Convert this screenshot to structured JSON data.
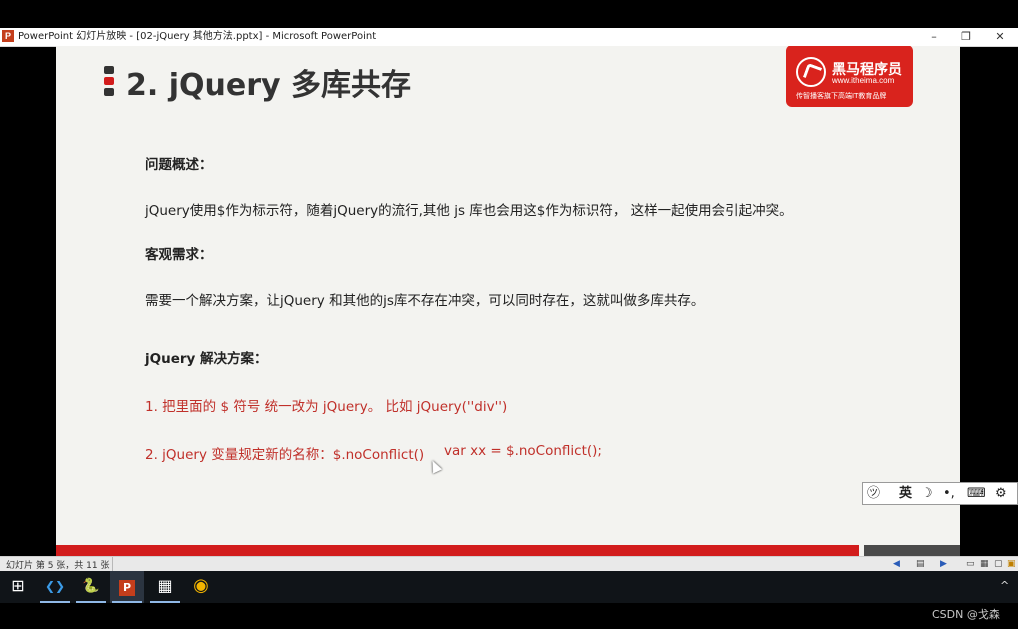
{
  "window": {
    "title": "PowerPoint 幻灯片放映 - [02-jQuery 其他方法.pptx] - Microsoft PowerPoint",
    "app_icon_letter": "P",
    "minimize_glyph": "–",
    "restore_glyph": "❐",
    "close_glyph": "✕"
  },
  "slide": {
    "title": "2. jQuery 多库共存",
    "bullet_colors": [
      "#333333",
      "#d21c1c",
      "#333333"
    ],
    "logo": {
      "name": "黑马程序员",
      "url": "www.itheima.com",
      "slogan": "传智播客旗下高端IT教育品牌",
      "bg_color": "#d9231d"
    },
    "problem_heading": "问题概述：",
    "problem_text": "jQuery使用$作为标示符，随着jQuery的流行,其他 js 库也会用这$作为标识符， 这样一起使用会引起冲突。",
    "need_heading": "客观需求：",
    "need_text": "需要一个解决方案，让jQuery 和其他的js库不存在冲突，可以同时存在，这就叫做多库共存。",
    "solution_heading": "jQuery 解决方案：",
    "solution_1": "1. 把里面的 $ 符号 统一改为 jQuery。 比如 jQuery(''div'')",
    "solution_2": "2.  jQuery 变量规定新的名称：$.noConflict()",
    "solution_2_code": "var xx = $.noConflict();",
    "accent_color": "#c0302a"
  },
  "ime": {
    "items": [
      "㋡",
      "英",
      "☽",
      "•,",
      "⌨",
      "⚙"
    ]
  },
  "statusbar": {
    "text": "幻灯片 第 5 张，共 11 张"
  },
  "taskbar": {
    "items": [
      {
        "name": "windows-start-icon",
        "glyph": "⊞"
      },
      {
        "name": "vscode-icon",
        "glyph": "❮❯"
      },
      {
        "name": "python-icon",
        "glyph": "🐍"
      },
      {
        "name": "powerpoint-icon",
        "glyph": "P"
      },
      {
        "name": "app-icon",
        "glyph": "▦"
      },
      {
        "name": "chrome-icon",
        "glyph": "◉"
      }
    ],
    "tray_arrow": "^"
  },
  "watermark": "CSDN @戈森"
}
